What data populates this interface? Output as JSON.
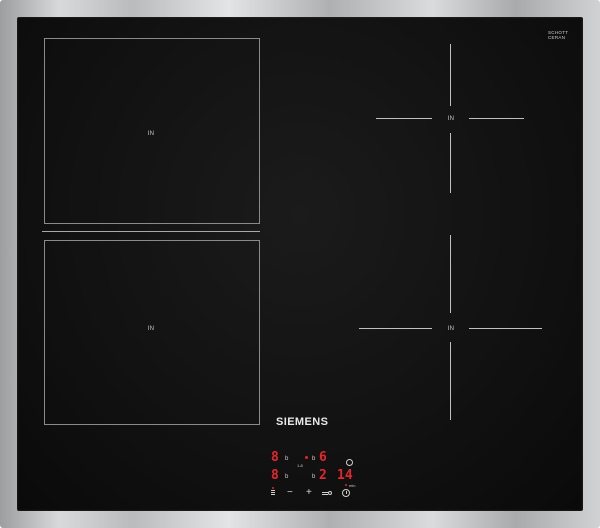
{
  "brand": "SIEMENS",
  "glass_maker": {
    "line1": "SCHOTT",
    "line2": "CERAN",
    "code": ""
  },
  "model_code": "",
  "zones": {
    "front_left": {
      "label": "IN"
    },
    "rear_left": {
      "label": "IN"
    },
    "rear_right": {
      "label": "IN"
    },
    "front_right": {
      "label": "IN"
    }
  },
  "control_panel": {
    "display_rear_left": "8",
    "display_front_left": "8",
    "display_rear_right": "6",
    "display_front_right": "2",
    "timer_display": "14",
    "indicator_b": "b",
    "combine_label": "1-8",
    "minus_symbol": "−",
    "plus_symbol": "+",
    "timer_unit": "min"
  },
  "colors": {
    "display_red": "#e3262e",
    "glass_black": "#111111",
    "frame_steel": "#c0c2c4"
  },
  "icons": [
    "power-icon",
    "minus-icon",
    "plus-icon",
    "boost-icon",
    "timer-icon",
    "childlock-icon"
  ]
}
